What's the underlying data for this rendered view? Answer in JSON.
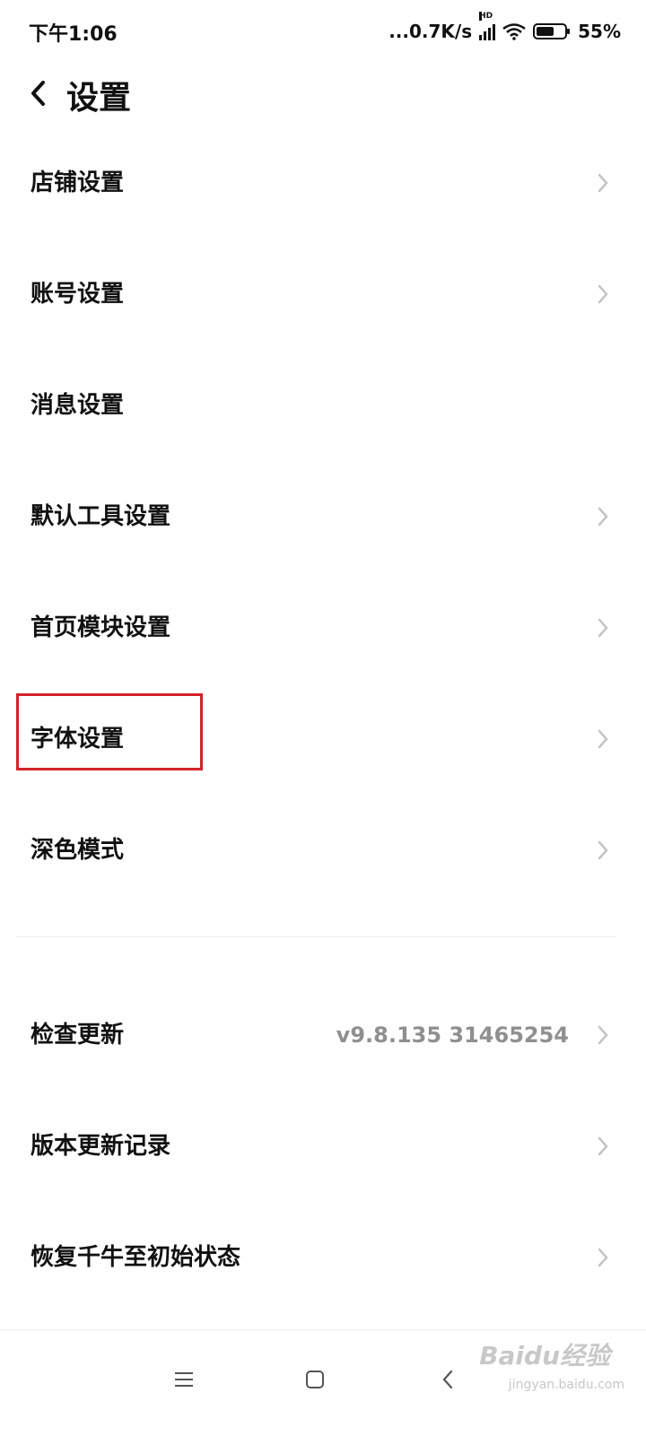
{
  "status": {
    "time": "下午1:06",
    "net_speed": "...0.7K/s",
    "hd": "HD",
    "battery": "55%"
  },
  "header": {
    "title": "设置",
    "back_icon": "chevron-left-icon"
  },
  "settings": [
    {
      "label": "店铺设置"
    },
    {
      "label": "账号设置"
    },
    {
      "label": "消息设置"
    },
    {
      "label": "默认工具设置"
    },
    {
      "label": "首页模块设置"
    },
    {
      "label": "字体设置"
    },
    {
      "label": "深色模式"
    }
  ],
  "system": [
    {
      "label": "检查更新",
      "value": "v9.8.135 31465254"
    },
    {
      "label": "版本更新记录"
    },
    {
      "label": "恢复千牛至初始状态"
    }
  ],
  "navbar": {
    "menu_icon": "menu-icon",
    "home_icon": "home-square-icon",
    "back_icon": "back-icon"
  },
  "watermark": {
    "brand": "Baidu经验",
    "url": "jingyan.baidu.com"
  },
  "colors": {
    "highlight": "#d2232a",
    "chevron": "#c4c4c4",
    "value_text": "#8f8f8f"
  }
}
